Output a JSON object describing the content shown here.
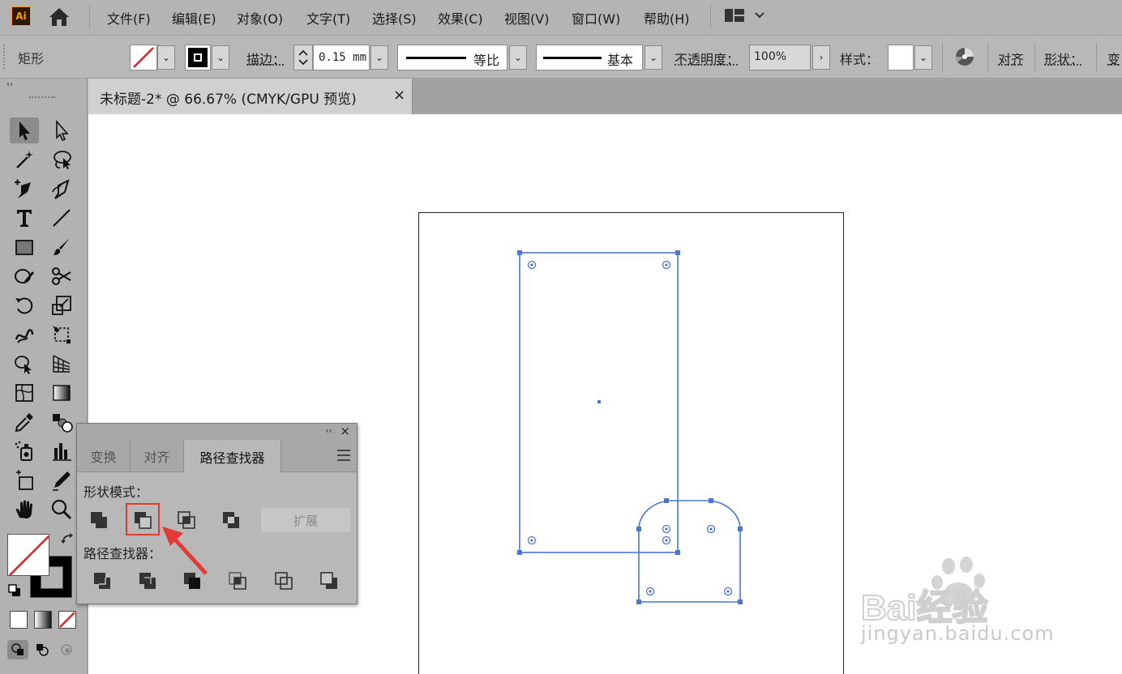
{
  "app": {
    "logo": "Ai"
  },
  "menu": {
    "items": [
      "文件(F)",
      "编辑(E)",
      "对象(O)",
      "文字(T)",
      "选择(S)",
      "效果(C)",
      "视图(V)",
      "窗口(W)",
      "帮助(H)"
    ]
  },
  "control_bar": {
    "tool_name": "矩形",
    "stroke_label": "描边：",
    "stroke_weight": "0.15 mm",
    "profile_label": "等比",
    "brush_label": "基本",
    "opacity_label": "不透明度：",
    "opacity_value": "100%",
    "style_label": "样式：",
    "align_label": "对齐",
    "shape_label": "形状：",
    "transform_label": "变"
  },
  "document": {
    "tab_title": "未标题-2* @ 66.67% (CMYK/GPU 预览)",
    "close_glyph": "×"
  },
  "pathfinder_panel": {
    "tabs": [
      "变换",
      "对齐",
      "路径查找器"
    ],
    "active_tab": "路径查找器",
    "shape_modes_label": "形状模式：",
    "pathfinders_label": "路径查找器：",
    "expand_label": "扩展",
    "collapse_glyph": "‹‹",
    "close_glyph": "×"
  },
  "tools_panel": {
    "collapse_glyph": "‹‹"
  },
  "watermark": {
    "text": "jingyan.baidu.com",
    "brand": "Bai经验"
  },
  "colors": {
    "selection": "#4a78d0",
    "highlight": "#e53935",
    "ui_gray": "#b8b8b8"
  }
}
